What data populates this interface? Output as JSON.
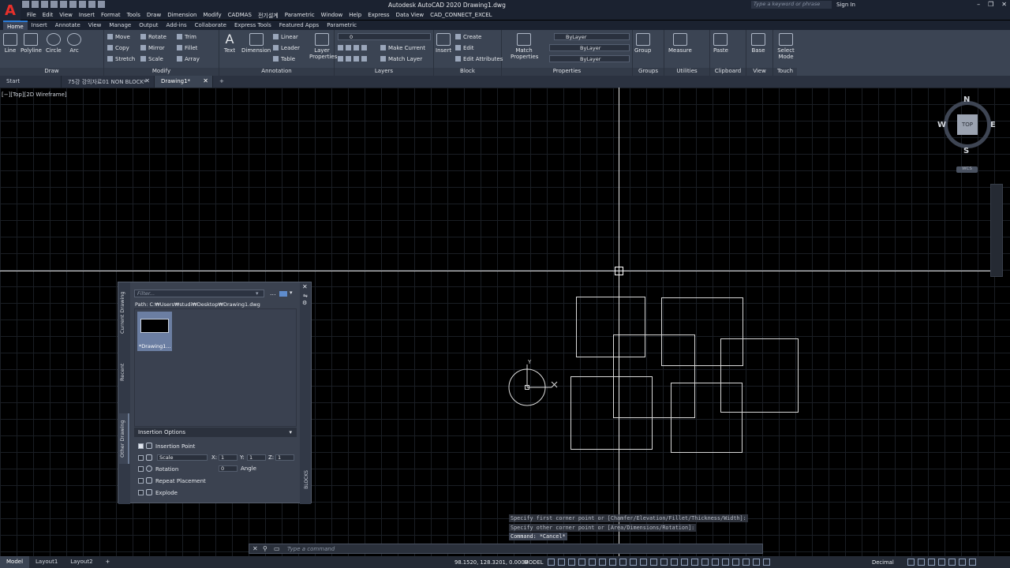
{
  "app": {
    "logo_letter": "A",
    "title": "Autodesk AutoCAD 2020    Drawing1.dwg",
    "search_placeholder": "Type a keyword or phrase",
    "sign_in": "Sign In",
    "window_controls": [
      "–",
      "❐",
      "✕"
    ]
  },
  "menu": [
    "File",
    "Edit",
    "View",
    "Insert",
    "Format",
    "Tools",
    "Draw",
    "Dimension",
    "Modify",
    "CADMAS",
    "전기설계",
    "Parametric",
    "Window",
    "Help",
    "Express",
    "Data View",
    "CAD_CONNECT_EXCEL"
  ],
  "ribbon_tabs": [
    "Home",
    "Insert",
    "Annotate",
    "View",
    "Manage",
    "Output",
    "Add-ins",
    "Collaborate",
    "Express Tools",
    "Featured Apps",
    "Parametric"
  ],
  "ribbon": {
    "draw": {
      "title": "Draw",
      "tools": [
        "Line",
        "Polyline",
        "Circle",
        "Arc"
      ]
    },
    "modify": {
      "title": "Modify",
      "tools": [
        "Move",
        "Rotate",
        "Trim",
        "Copy",
        "Mirror",
        "Fillet",
        "Stretch",
        "Scale",
        "Array"
      ]
    },
    "annotation": {
      "title": "Annotation",
      "text": "Text",
      "dimension": "Dimension",
      "small": [
        "Linear",
        "Leader",
        "Table"
      ]
    },
    "layers": {
      "title": "Layers",
      "layer_properties": "Layer Properties",
      "layer_value": "0",
      "make_current": "Make Current",
      "match_layer": "Match Layer"
    },
    "block": {
      "title": "Block",
      "insert": "Insert",
      "create": "Create",
      "edit": "Edit",
      "edit_attributes": "Edit Attributes"
    },
    "properties": {
      "title": "Properties",
      "match": "Match Properties",
      "color": "ByLayer",
      "linetype": "ByLayer",
      "lineweight": "ByLayer"
    },
    "groups": {
      "title": "Groups",
      "group": "Group"
    },
    "utilities": {
      "title": "Utilities",
      "measure": "Measure"
    },
    "clipboard": {
      "title": "Clipboard",
      "paste": "Paste"
    },
    "view": {
      "title": "View",
      "base": "Base"
    },
    "touch": {
      "title": "Touch",
      "select_mode": "Select Mode"
    }
  },
  "doc_tabs": [
    {
      "label": "Start",
      "active": false
    },
    {
      "label": "75강 강의자료01 NON BLOCK*",
      "active": false
    },
    {
      "label": "Drawing1*",
      "active": true
    }
  ],
  "viewport_label": "[−][Top][2D Wireframe]",
  "viewcube": {
    "top": "TOP",
    "n": "N",
    "s": "S",
    "e": "E",
    "w": "W",
    "wcs": "WCS"
  },
  "ucs": {
    "x": "X",
    "y": "Y"
  },
  "palette": {
    "side_tabs": [
      "Current Drawing",
      "Recent",
      "Other Drawing"
    ],
    "filter_placeholder": "Filter...",
    "path": "Path: C:₩Users₩studi₩Desktop₩Drawing1.dwg",
    "thumb_label": "*Drawing1...",
    "options_header": "Insertion Options",
    "insertion_point": "Insertion Point",
    "scale": "Scale",
    "x_label": "X:",
    "x_val": "1",
    "y_label": "Y:",
    "y_val": "1",
    "z_label": "Z:",
    "z_val": "1",
    "rotation": "Rotation",
    "rotation_val": "0",
    "angle": "Angle",
    "repeat_placement": "Repeat Placement",
    "explode": "Explode",
    "blocks_label": "BLOCKS"
  },
  "command": {
    "history": [
      "Specify first corner point or [Chamfer/Elevation/Fillet/Thickness/Width]:",
      "Specify other corner point or [Area/Dimensions/Rotation]:",
      "Command: *Cancel*"
    ],
    "placeholder": "Type a command"
  },
  "status": {
    "tabs": [
      "Model",
      "Layout1",
      "Layout2"
    ],
    "add": "+",
    "coords": "98.1520, 128.3201, 0.0000",
    "model": "MODEL",
    "units": "Decimal"
  }
}
